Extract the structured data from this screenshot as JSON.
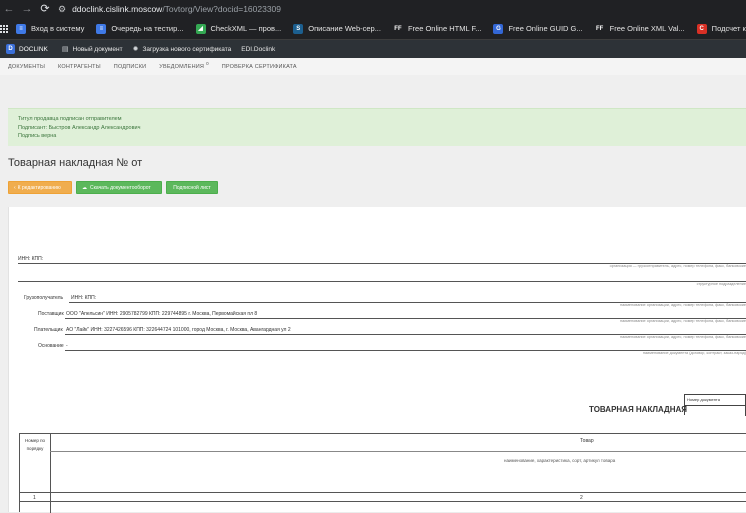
{
  "browser": {
    "url_host": "ddoclink.cislink.moscow",
    "url_path": "/Tovtorg/View?docid=16023309",
    "bookmarks": [
      {
        "label": "Вход в систему",
        "icon": "db-icon",
        "color": "#3f79e6",
        "glyph": "≡"
      },
      {
        "label": "Очередь на тестир...",
        "icon": "db-icon",
        "color": "#3f79e6",
        "glyph": "≡"
      },
      {
        "label": "CheckXML — пров...",
        "icon": "checkxml-icon",
        "color": "#34a853",
        "glyph": "◢"
      },
      {
        "label": "Описание Web-сер...",
        "icon": "s-icon",
        "color": "#1c5f8f",
        "glyph": "S"
      },
      {
        "label": "Free Online HTML F...",
        "icon": "ff-icon",
        "color": "#202124",
        "glyph": "FF"
      },
      {
        "label": "Free Online GUID G...",
        "icon": "guid-icon",
        "color": "#3367d6",
        "glyph": "G"
      },
      {
        "label": "Free Online XML Val...",
        "icon": "ff-icon",
        "color": "#202124",
        "glyph": "FF"
      },
      {
        "label": "Подсчет количеств...",
        "icon": "counter-icon",
        "color": "#d93025",
        "glyph": "C"
      }
    ]
  },
  "site": {
    "brand": "DOCLINK",
    "links": [
      "Новый документ",
      "Загрузка нового сертификата",
      "EDI.Doclink"
    ]
  },
  "menu": {
    "items": [
      "ДОКУМЕНТЫ",
      "КОНТРАГЕНТЫ",
      "ПОДПИСКИ",
      "УВЕДОМЛЕНИЯ",
      "ПРОВЕРКА СЕРТИФИКАТА"
    ],
    "notifications_badge": "0"
  },
  "alert": {
    "line1": "Титул продавца подписан отправителем",
    "line2": "Подписант: Быстров Александр Александрович",
    "line3": "Подпись верна"
  },
  "page": {
    "heading": "Товарная накладная №   от"
  },
  "buttons": {
    "back": "К редактированию",
    "download": "Скачать документооборот",
    "sheet": "Подписной лист"
  },
  "document": {
    "inn_kpp": "ИНН: КПП:",
    "cap_org": "организация — грузоотправитель, адрес, номер телефона, факс, банковские",
    "cap_dept": "структурное подразделение",
    "consignee_label": "Грузополучатель",
    "consignee_value": "ИНН: КПП:",
    "cap_name1": "наименование организации, адрес, номер телефона, факс, банковские",
    "supplier_label": "Поставщик",
    "supplier_value": "ООО \"Апельсин\" ИНН: 2905782799 КПП: 229744895 г. Москва, Первомайская пл 8",
    "cap_name2": "наименование организации, адрес, номер телефона, факс, банковские",
    "payer_label": "Плательщик",
    "payer_value": "АО \"Лайк\"  ИНН: 3227426596 КПП: 322644724 101000, город Москва, г. Москва, Авангардная ул 2",
    "cap_name3": "наименование организации, адрес, номер телефона, факс, банковские",
    "basis_label": "Основание",
    "basis_value": "-",
    "cap_basis": "наименование документа (договор, контракт, заказ-наряд)",
    "title": "ТОВАРНАЯ НАКЛАДНАЯ",
    "docnum_label": "Номер документа",
    "table": {
      "col1_header": "Номер по порядку",
      "col2_header": "Товар",
      "col2_sub": "наименование, характеристика, сорт, артикул товара",
      "num1": "1",
      "num2": "2"
    }
  }
}
